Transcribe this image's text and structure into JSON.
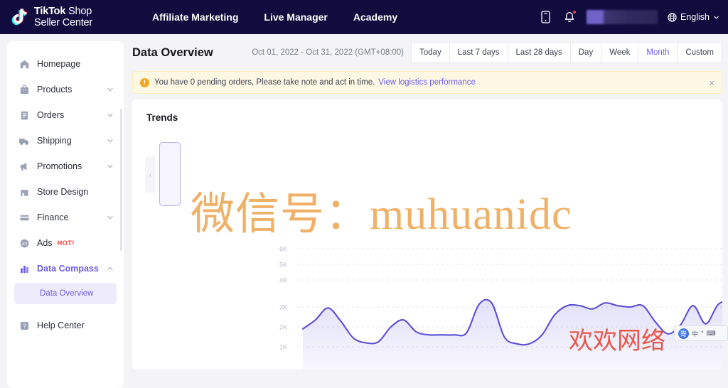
{
  "header": {
    "logo": {
      "line1_bold": "TikTok",
      "line1_thin": " Shop",
      "line2": "Seller Center",
      "icon": "tiktok-note-icon"
    },
    "nav": [
      {
        "label": "Affiliate Marketing"
      },
      {
        "label": "Live Manager"
      },
      {
        "label": "Academy"
      }
    ],
    "icons": {
      "mobile": "mobile-icon",
      "bell": "bell-icon"
    },
    "language": {
      "label": "English",
      "icon": "globe-icon",
      "chevron": "chevron-down-icon"
    }
  },
  "sidebar": {
    "items": [
      {
        "label": "Homepage",
        "icon": "home-icon",
        "expandable": false,
        "active": false
      },
      {
        "label": "Products",
        "icon": "bag-icon",
        "expandable": true,
        "active": false
      },
      {
        "label": "Orders",
        "icon": "clipboard-icon",
        "expandable": true,
        "active": false
      },
      {
        "label": "Shipping",
        "icon": "truck-icon",
        "expandable": true,
        "active": false
      },
      {
        "label": "Promotions",
        "icon": "megaphone-icon",
        "expandable": true,
        "active": false
      },
      {
        "label": "Store Design",
        "icon": "storefront-icon",
        "expandable": false,
        "active": false
      },
      {
        "label": "Finance",
        "icon": "card-icon",
        "expandable": true,
        "active": false
      },
      {
        "label": "Ads",
        "icon": "ads-icon",
        "expandable": false,
        "active": false,
        "badge": "HOT!"
      },
      {
        "label": "Data Compass",
        "icon": "bar-chart-icon",
        "expandable": true,
        "active": true,
        "expanded": true
      }
    ],
    "sub_item": {
      "label": "Data Overview",
      "parent": "Data Compass",
      "selected": true
    },
    "help": {
      "label": "Help Center",
      "icon": "help-icon"
    }
  },
  "toolbar": {
    "page_title": "Data Overview",
    "date_range": "Oct 01, 2022 - Oct 31, 2022 (GMT+08:00)",
    "filters": [
      {
        "label": "Today",
        "active": false
      },
      {
        "label": "Last 7 days",
        "active": false
      },
      {
        "label": "Last 28 days",
        "active": false
      },
      {
        "label": "Day",
        "active": false
      },
      {
        "label": "Week",
        "active": false
      },
      {
        "label": "Month",
        "active": true
      },
      {
        "label": "Custom",
        "active": false
      }
    ]
  },
  "alert": {
    "icon": "warning-icon",
    "icon_glyph": "!",
    "text": "You have 0 pending orders, Please take note and act in time.",
    "link": "View logistics performance",
    "close": "×"
  },
  "panel": {
    "title": "Trends",
    "prev_arrow": "‹",
    "prev_arrow_name": "chevron-left-icon"
  },
  "watermarks": {
    "orange": "微信号：muhuanidc",
    "red": "欢欢网络",
    "ime_logo": "嵜",
    "ime_mode": "中"
  },
  "colors": {
    "header_bg": "#120c3e",
    "accent": "#6b5ce7",
    "line": "#5b4fd6",
    "alert_bg": "#fdf8e4",
    "hot": "#ff3c3c",
    "watermark_orange": "#eeab5c",
    "watermark_red": "#e8574a"
  },
  "chart_data": {
    "type": "area",
    "title": "Trends",
    "xlabel": "",
    "ylabel": "",
    "grid": true,
    "legend": "none",
    "ylim": [
      0,
      6500
    ],
    "yticks": [
      "1K",
      "2K",
      "3K",
      "4K",
      "5K",
      "6K"
    ],
    "ytick_values": [
      1000,
      2000,
      3000,
      4000,
      5000,
      6000
    ],
    "series": [
      {
        "name": "Trend",
        "color": "#5b4fd6",
        "values": [
          1900,
          2350,
          2950,
          2300,
          1450,
          1200,
          1250,
          2000,
          2350,
          1750,
          1600,
          1600,
          1600,
          1700,
          3100,
          3150,
          1500,
          1150,
          1150,
          1600,
          2600,
          3050,
          3050,
          2900,
          3150,
          3050,
          3000,
          3050,
          2250,
          1650,
          2100,
          3050,
          2150,
          3100,
          3250
        ]
      }
    ]
  }
}
